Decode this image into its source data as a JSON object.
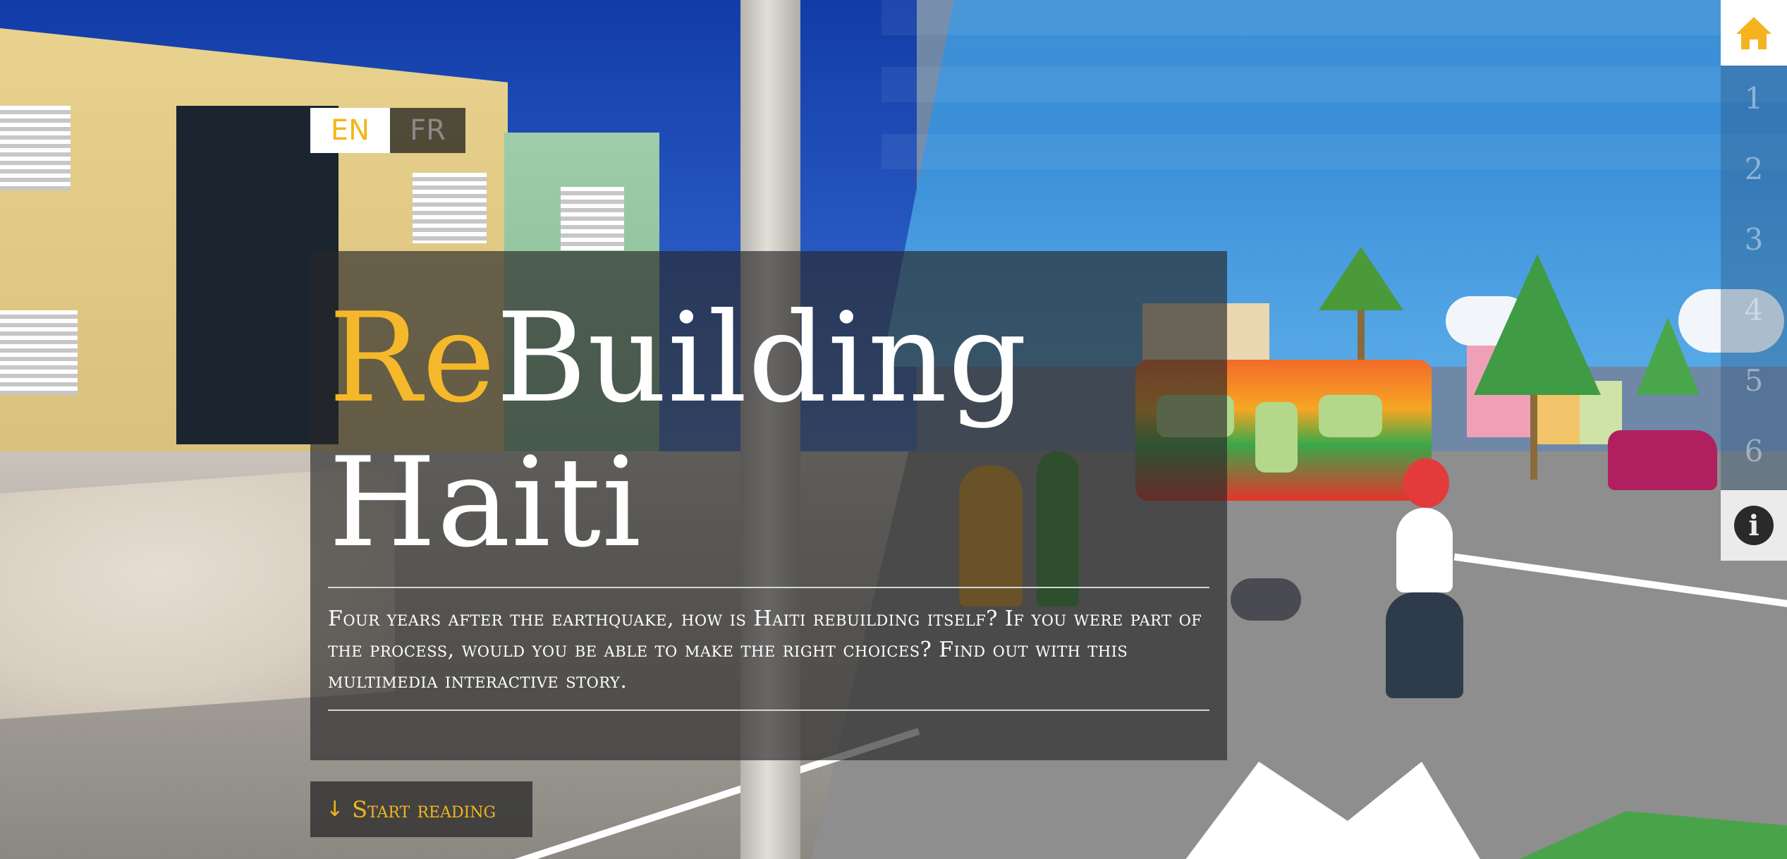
{
  "language_switch": {
    "options": [
      {
        "label": "EN",
        "selected": true
      },
      {
        "label": "FR",
        "selected": false
      }
    ]
  },
  "hero": {
    "title_accent": "Re",
    "title_rest_line1": "Building",
    "title_line2": "Haiti",
    "subtitle": "Four years after the earthquake, how is Haiti rebuilding itself? If you were part of the process, would you be able to make the right choices? Find out with this multimedia interactive story."
  },
  "start_button": {
    "label": "Start reading"
  },
  "side_nav": {
    "home_icon": "home-icon",
    "chapters": [
      "1",
      "2",
      "3",
      "4",
      "5",
      "6"
    ],
    "info_icon": "info-icon",
    "info_label": "i"
  },
  "colors": {
    "accent": "#f3b51b",
    "panel": "#282828"
  }
}
